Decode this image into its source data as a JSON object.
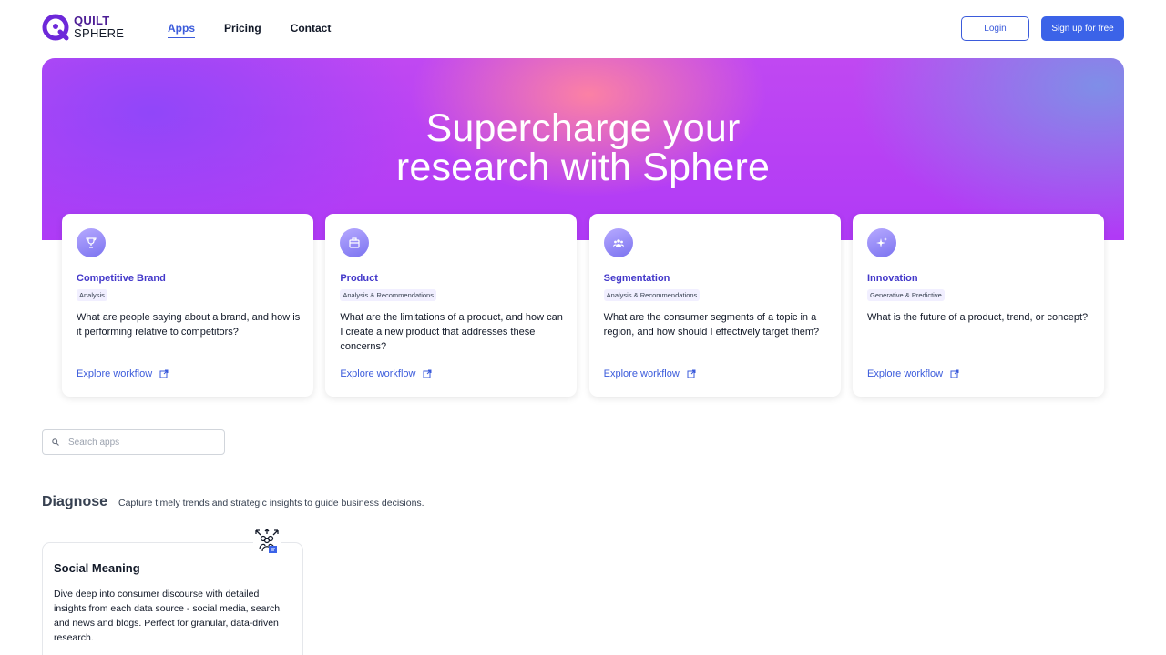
{
  "header": {
    "logo": {
      "line1": "QUILT",
      "line2": "SPHERE"
    },
    "nav": [
      {
        "label": "Apps",
        "active": true
      },
      {
        "label": "Pricing",
        "active": false
      },
      {
        "label": "Contact",
        "active": false
      }
    ],
    "login_label": "Login",
    "signup_label": "Sign up for free"
  },
  "hero": {
    "title_line1": "Supercharge your",
    "title_line2": "research with Sphere"
  },
  "workflows": [
    {
      "icon": "trophy-icon",
      "title": "Competitive Brand",
      "badge": "Analysis",
      "description": "What are people saying about a brand, and how is it performing relative to competitors?",
      "link": "Explore workflow"
    },
    {
      "icon": "box-icon",
      "title": "Product",
      "badge": "Analysis & Recommendations",
      "description": "What are the limitations of a product, and how can I create a new product that addresses these concerns?",
      "link": "Explore workflow"
    },
    {
      "icon": "people-group-icon",
      "title": "Segmentation",
      "badge": "Analysis & Recommendations",
      "description": "What are the consumer segments of a topic in a region, and how should I effectively target them?",
      "link": "Explore workflow"
    },
    {
      "icon": "sparkles-icon",
      "title": "Innovation",
      "badge": "Generative & Predictive",
      "description": "What is the future of a product, trend, or concept?",
      "link": "Explore workflow"
    }
  ],
  "search": {
    "placeholder": "Search apps",
    "value": ""
  },
  "section": {
    "title": "Diagnose",
    "subtitle": "Capture timely trends and strategic insights to guide business decisions."
  },
  "apps": [
    {
      "icon": "social-meaning-icon",
      "title": "Social Meaning",
      "description": "Dive deep into consumer discourse with detailed insights from each data source - social media, search, and news and blogs. Perfect for granular, data-driven research."
    }
  ],
  "colors": {
    "accent": "#3b5bdb",
    "brand_purple": "#4c1d95",
    "card_title": "#4338ca"
  }
}
